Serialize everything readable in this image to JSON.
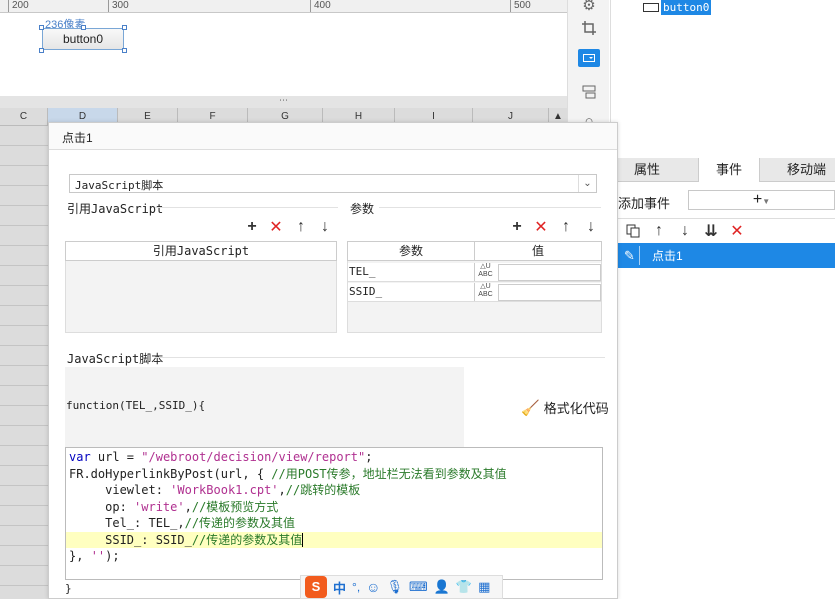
{
  "ruler": {
    "ticks": [
      "200",
      "300",
      "400",
      "500"
    ]
  },
  "canvas": {
    "size_label": "236像素",
    "button_label": "button0"
  },
  "divider": {
    "grip": "⋯"
  },
  "columns": [
    "C",
    "D",
    "E",
    "F",
    "G",
    "H",
    "I",
    "J"
  ],
  "tree": {
    "selected_node": "button0"
  },
  "tabs": {
    "properties": "属性",
    "events": "事件",
    "mobile": "移动端"
  },
  "events_panel": {
    "add_event_label": "添加事件",
    "add_symbol": "+",
    "items": [
      {
        "label": "点击1"
      }
    ]
  },
  "dialog": {
    "title": "点击1",
    "type_select": "JavaScript脚本",
    "ref_section_title": "引用JavaScript",
    "ref_table_header": "引用JavaScript",
    "params_section_title": "参数",
    "params_table": {
      "headers": [
        "参数",
        "值"
      ],
      "rows": [
        {
          "name": "TEL_",
          "value": ""
        },
        {
          "name": "SSID_",
          "value": ""
        }
      ]
    },
    "script_section_title": "JavaScript脚本",
    "function_signature": "function(TEL_,SSID_){",
    "format_button": "格式化代码",
    "closing_brace": "}",
    "code_lines": [
      "var url = \"/webroot/decision/view/report\";",
      "FR.doHyperlinkByPost(url, { //用POST传参，地址栏无法看到参数及其值",
      "     viewlet: 'WorkBook1.cpt',//跳转的模板",
      "     op: 'write',//模板预览方式",
      "     Tel_: TEL_,//传递的参数及其值",
      "     SSID_: SSID_//传递的参数及其值",
      "}, '');"
    ]
  },
  "ime_bar": {
    "label": "中",
    "punct": "°,"
  },
  "colors": {
    "accent": "#1e88e5",
    "highlight_line": "#ffffc0",
    "delete": "#e02424"
  }
}
